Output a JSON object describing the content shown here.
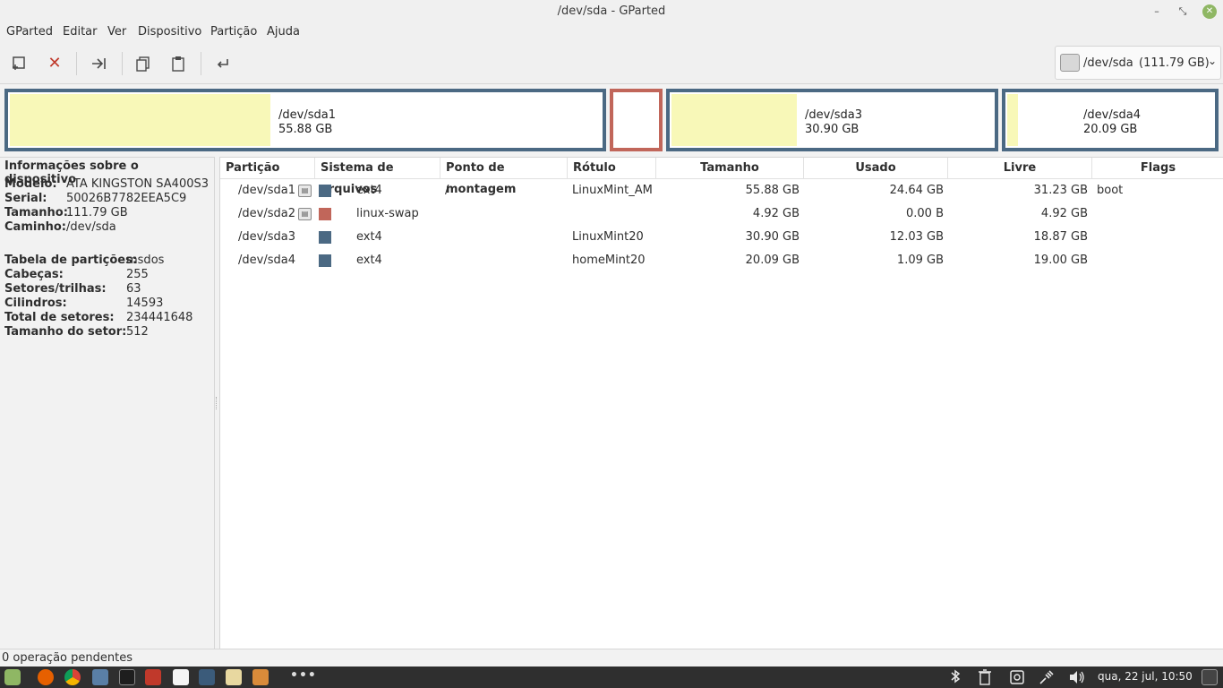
{
  "window": {
    "title": "/dev/sda - GParted",
    "min_glyph": "–",
    "max_glyph": "⤡",
    "close_glyph": "✕"
  },
  "menu": [
    "GParted",
    "Editar",
    "Ver",
    "Dispositivo",
    "Partição",
    "Ajuda"
  ],
  "toolbar": {
    "buttons": [
      "new-partition-icon",
      "delete-partition-icon",
      "resize-move-icon",
      "copy-icon",
      "paste-icon",
      "undo-icon"
    ],
    "device_name": "/dev/sda",
    "device_size": "(111.79 GB)"
  },
  "partition_map": [
    {
      "name": "/dev/sda1",
      "size": "55.88 GB",
      "used_fraction": 0.441
    },
    {
      "name": "",
      "size": "",
      "used_fraction": 0
    },
    {
      "name": "/dev/sda3",
      "size": "30.90 GB",
      "used_fraction": 0.389
    },
    {
      "name": "/dev/sda4",
      "size": "20.09 GB",
      "used_fraction": 0.054
    }
  ],
  "device_info": {
    "title": "Informações sobre o dispositivo",
    "rows": [
      {
        "k": "Modelo:",
        "v": "ATA KINGSTON SA400S3"
      },
      {
        "k": "Serial:",
        "v": "50026B7782EEA5C9"
      },
      {
        "k": "Tamanho:",
        "v": "111.79 GB"
      },
      {
        "k": "Caminho:",
        "v": "/dev/sda"
      },
      {
        "k": "Tabela de partições:",
        "v": "msdos"
      },
      {
        "k": "Cabeças:",
        "v": "255"
      },
      {
        "k": "Setores/trilhas:",
        "v": "63"
      },
      {
        "k": "Cilindros:",
        "v": "14593"
      },
      {
        "k": "Total de setores:",
        "v": "234441648"
      },
      {
        "k": "Tamanho do setor:",
        "v": "512"
      }
    ]
  },
  "table": {
    "headers": [
      "Partição",
      "Sistema de arquivos",
      "Ponto de montagem",
      "Rótulo",
      "Tamanho",
      "Usado",
      "Livre",
      "Flags"
    ],
    "rows": [
      {
        "partition": "/dev/sda1",
        "fs": "ext4",
        "mount": "/",
        "label": "LinuxMint_AM",
        "size": "55.88 GB",
        "used": "24.64 GB",
        "free": "31.23 GB",
        "flags": "boot"
      },
      {
        "partition": "/dev/sda2",
        "fs": "linux-swap",
        "mount": "",
        "label": "",
        "size": "4.92 GB",
        "used": "0.00 B",
        "free": "4.92 GB",
        "flags": ""
      },
      {
        "partition": "/dev/sda3",
        "fs": "ext4",
        "mount": "",
        "label": "LinuxMint20",
        "size": "30.90 GB",
        "used": "12.03 GB",
        "free": "18.87 GB",
        "flags": ""
      },
      {
        "partition": "/dev/sda4",
        "fs": "ext4",
        "mount": "",
        "label": "homeMint20",
        "size": "20.09 GB",
        "used": "1.09 GB",
        "free": "19.00 GB",
        "flags": ""
      }
    ]
  },
  "status": "0 operação pendentes",
  "taskbar": {
    "clock": "qua, 22 jul, 10:50",
    "more_glyph": "•••"
  },
  "colors": {
    "ext4": "#4b6983",
    "linux_swap": "#c1665a",
    "used": "#f8f8b8"
  }
}
